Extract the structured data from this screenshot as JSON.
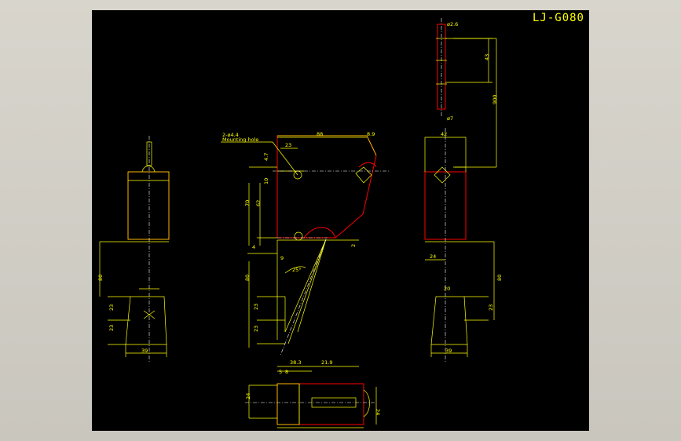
{
  "drawing": {
    "title": "LJ-G080",
    "note_holes": "2-ø4.4",
    "note_mounting": "Mounting hole",
    "colors": {
      "background": "#000000",
      "outline": "#ff0000",
      "dimension": "#ffff00",
      "center": "#ffffff",
      "frame": "#d4d0c8"
    }
  },
  "dims": {
    "d_phi26": "ø2.6",
    "d_43": "43",
    "d_900": "900",
    "d_phi7": "ø7",
    "d_42": "42",
    "d_24_right": "24",
    "d_80_right": "80",
    "d_20_right": "20",
    "d_39_right": "39",
    "d_23_right": "23",
    "d_88": "88",
    "d_89": "8.9",
    "d_23_top": "23",
    "d_47": "4.7",
    "d_10": "10",
    "d_62": "62",
    "d_70": "70",
    "d_4": "4",
    "d_9": "9",
    "d_2": "2",
    "d_25": "25°",
    "d_80_mid": "80",
    "d_23_mid1": "23",
    "d_23_mid2": "23",
    "d_80_left": "80",
    "d_23_left1": "23",
    "d_23_left2": "23",
    "d_39_left": "39",
    "d_383": "38.3",
    "d_219": "21.9",
    "d_5": "5",
    "d_8": "8",
    "d_24_bottom": "24",
    "d_24_bottom2": "24"
  }
}
